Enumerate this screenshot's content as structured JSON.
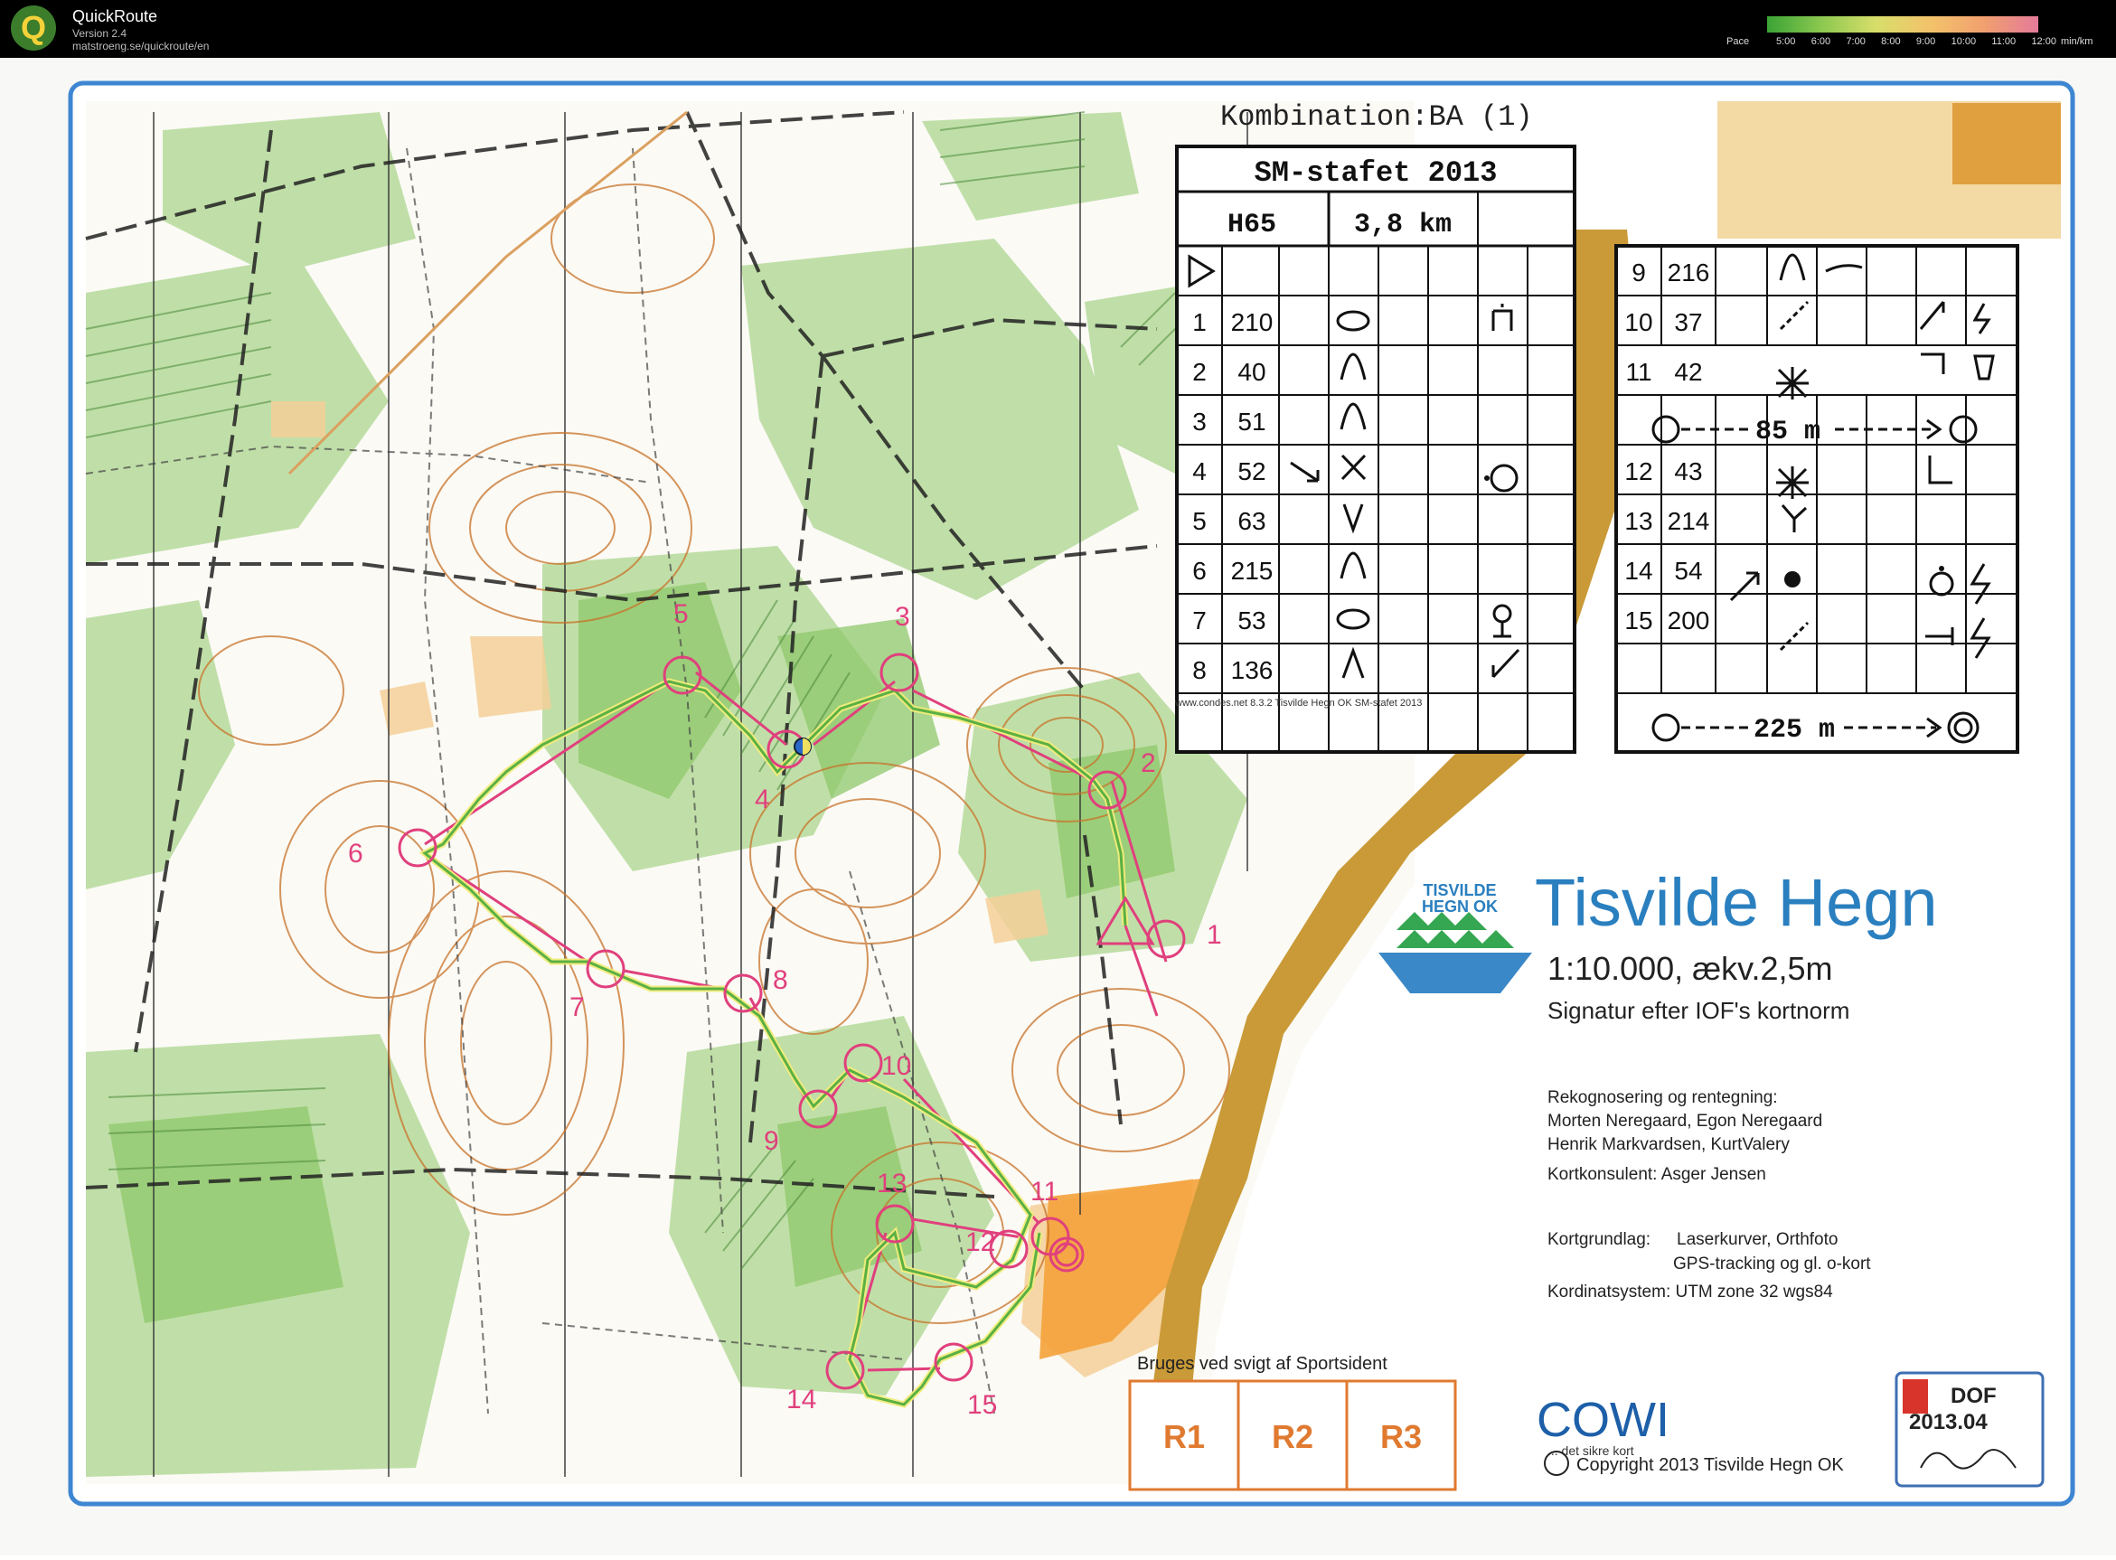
{
  "app": {
    "logo_letter": "Q",
    "title": "QuickRoute",
    "version": "Version 2.4",
    "url": "matstroeng.se/quickroute/en"
  },
  "pace_legend": {
    "label": "Pace",
    "ticks": [
      "5:00",
      "6:00",
      "7:00",
      "8:00",
      "9:00",
      "10:00",
      "11:00",
      "12:00"
    ],
    "unit": "min/km",
    "colors": [
      "#3aa335",
      "#7cc24a",
      "#b9d95a",
      "#e9e06a",
      "#f3c36b",
      "#f2a46a",
      "#ee8f8a",
      "#e07a9a"
    ]
  },
  "map": {
    "header_text": "Kombination:BA (1)",
    "event": "SM-stafet 2013",
    "class": "H65",
    "length": "3,8 km",
    "controls_left": [
      {
        "num": "1",
        "code": "210"
      },
      {
        "num": "2",
        "code": "40"
      },
      {
        "num": "3",
        "code": "51"
      },
      {
        "num": "4",
        "code": "52"
      },
      {
        "num": "5",
        "code": "63"
      },
      {
        "num": "6",
        "code": "215"
      },
      {
        "num": "7",
        "code": "53"
      },
      {
        "num": "8",
        "code": "136"
      }
    ],
    "controls_right": [
      {
        "num": "9",
        "code": "216"
      },
      {
        "num": "10",
        "code": "37"
      },
      {
        "num": "11",
        "code": "42"
      },
      {
        "num": "12",
        "code": "43"
      },
      {
        "num": "13",
        "code": "214"
      },
      {
        "num": "14",
        "code": "54"
      },
      {
        "num": "15",
        "code": "200"
      }
    ],
    "taped_route_1": "85 m",
    "taped_route_2": "225 m",
    "map_title": "Tisvilde Hegn",
    "club_logo_line1": "TISVILDE",
    "club_logo_line2": "HEGN OK",
    "scale": "1:10.000,  ækv.2,5m",
    "norm": "Signatur efter IOF's kortnorm",
    "credits_heading": "Rekognosering og rentegning:",
    "credits_line1": "Morten Neregaard, Egon Neregaard",
    "credits_line2": "Henrik Markvardsen, KurtValery",
    "consultant": "Kortkonsulent: Asger Jensen",
    "basis_label": "Kortgrundlag:",
    "basis_line1": "Laserkurver, Orthfoto",
    "basis_line2": "GPS-tracking og gl. o-kort",
    "coords": "Kordinatsystem: UTM zone 32 wgs84",
    "sportident_note": "Bruges ved svigt af Sportsident",
    "boxes": [
      "R1",
      "R2",
      "R3"
    ],
    "cowi": "COWI",
    "cowi_tag": "... det sikre kort",
    "copyright": "Copyright 2013 Tisvilde Hegn OK",
    "dof_label": "DOF",
    "dof_number": "2013.04",
    "small_print": "www.condes.net 8.3.2 Tisvilde Hegn OK SM-stafet 2013",
    "course_labels": [
      "1",
      "2",
      "3",
      "4",
      "5",
      "6",
      "7",
      "8",
      "9",
      "10",
      "11",
      "12",
      "13",
      "14",
      "15"
    ]
  }
}
